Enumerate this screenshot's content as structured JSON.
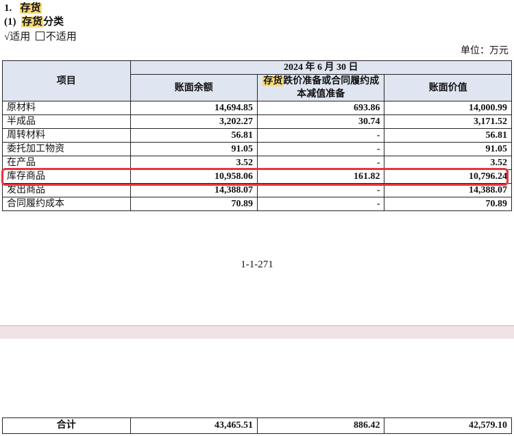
{
  "heading": {
    "num": "1.",
    "title": "存货",
    "sub_num": "(1)",
    "sub_title_hl": "存货",
    "sub_title_rest": "分类"
  },
  "applicability": {
    "checked_mark": "√",
    "checked_label": "适用",
    "unchecked_label": "不适用"
  },
  "unit": "单位：万元",
  "table": {
    "header_item": "项目",
    "header_date": "2024 年 6 月 30 日",
    "header_col1": "账面余额",
    "header_col2_hl": "存货",
    "header_col2_rest": "跌价准备或合同履约成本减值准备",
    "header_col3": "账面价值",
    "rows": [
      {
        "name": "原材料",
        "balance": "14,694.85",
        "provision": "693.86",
        "net": "14,000.99"
      },
      {
        "name": "半成品",
        "balance": "3,202.27",
        "provision": "30.74",
        "net": "3,171.52"
      },
      {
        "name": "周转材料",
        "balance": "56.81",
        "provision": "-",
        "net": "56.81"
      },
      {
        "name": "委托加工物资",
        "balance": "91.05",
        "provision": "-",
        "net": "91.05"
      },
      {
        "name": "在产品",
        "balance": "3.52",
        "provision": "-",
        "net": "3.52"
      },
      {
        "name": "库存商品",
        "balance": "10,958.06",
        "provision": "161.82",
        "net": "10,796.24"
      },
      {
        "name": "发出商品",
        "balance": "14,388.07",
        "provision": "-",
        "net": "14,388.07"
      },
      {
        "name": "合同履约成本",
        "balance": "70.89",
        "provision": "-",
        "net": "70.89"
      }
    ],
    "total": {
      "name": "合计",
      "balance": "43,465.51",
      "provision": "886.42",
      "net": "42,579.10"
    }
  },
  "page_number": "1-1-271",
  "highlight_color": "#e8323c"
}
